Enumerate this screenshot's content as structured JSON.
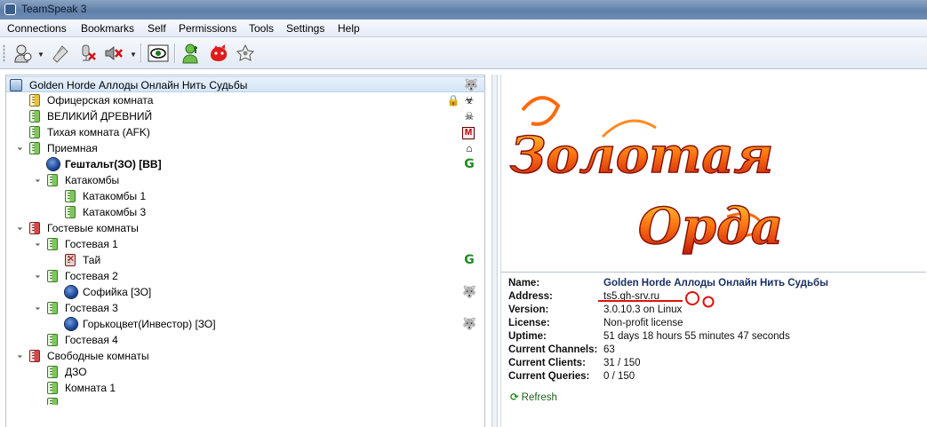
{
  "window": {
    "title": "TeamSpeak 3"
  },
  "menu": [
    "Connections",
    "Bookmarks",
    "Self",
    "Permissions",
    "Tools",
    "Settings",
    "Help"
  ],
  "toolbar": {
    "buttons": [
      "connect-icon",
      "disconnect-icon",
      "mute-microphone-icon",
      "mute-speakers-icon",
      "away-icon",
      "channel-commander-icon",
      "whisper-icon",
      "contacts-icon"
    ]
  },
  "tree": {
    "server": "Golden Horde Аллоды Онлайн  Нить Судьбы",
    "rows": [
      {
        "label": "Офицерская комната"
      },
      {
        "label": "ВЕЛИКИЙ ДРЕВНИЙ"
      },
      {
        "label": "Тихая комната (AFK)",
        "badge": "M"
      },
      {
        "label": "Приемная"
      },
      {
        "label": "Гештальт(ЗО) [BB]"
      },
      {
        "label": "Катакомбы"
      },
      {
        "label": "Катакомбы 1"
      },
      {
        "label": "Катакомбы 3"
      },
      {
        "label": "Гостевые комнаты"
      },
      {
        "label": "Гостевая 1"
      },
      {
        "label": "Тай"
      },
      {
        "label": "Гостевая 2"
      },
      {
        "label": "Софийка [ЗО]"
      },
      {
        "label": "Гостевая 3"
      },
      {
        "label": "Горькоцвет(Инвестор) [ЗО]"
      },
      {
        "label": "Гостевая 4"
      },
      {
        "label": "Свободные комнаты"
      },
      {
        "label": "ДЗО"
      },
      {
        "label": "Комната 1"
      }
    ]
  },
  "banner": {
    "line1": "Золотая",
    "line2": "Орда"
  },
  "info": {
    "name_key": "Name:",
    "name_val": "Golden Horde Аллоды Онлайн  Нить Судьбы",
    "address_key": "Address:",
    "address_val": "ts5.gh-srv.ru",
    "version_key": "Version:",
    "version_val": "3.0.10.3 on Linux",
    "license_key": "License:",
    "license_val": "Non-profit license",
    "uptime_key": "Uptime:",
    "uptime_val": "51 days 18 hours 55 minutes 47 seconds",
    "channels_key": "Current Channels:",
    "channels_val": "63",
    "clients_key": "Current Clients:",
    "clients_val": "31 / 150",
    "queries_key": "Current Queries:",
    "queries_val": "0 / 150",
    "refresh": "Refresh"
  },
  "colors": {
    "accent": "#1a2f63",
    "mark": "#e01010",
    "selection": "#d4e5f8"
  }
}
